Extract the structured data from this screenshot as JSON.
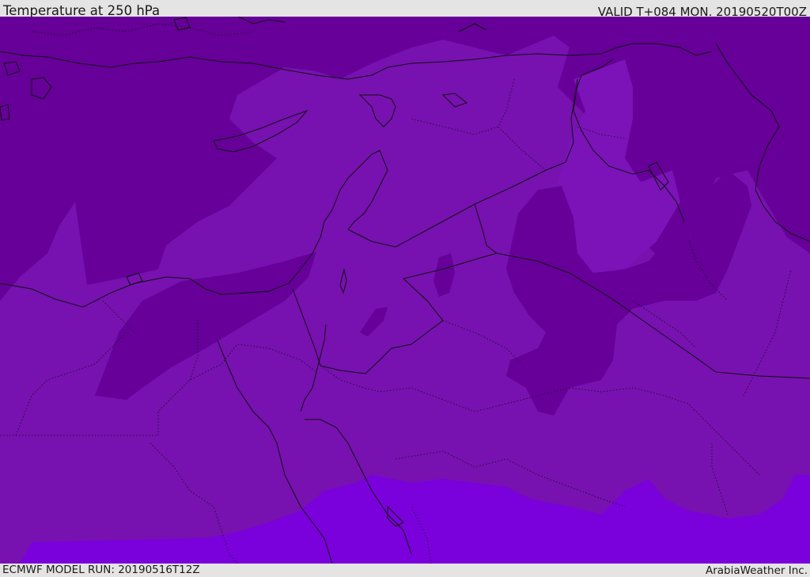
{
  "header": {
    "title": "Temperature at 250 hPa",
    "valid_time": "VALID T+084 MON. 20190520T00Z"
  },
  "footer": {
    "model_run": "ECMWF MODEL RUN: 20190516T12Z",
    "credit": "ArabiaWeather Inc."
  },
  "map": {
    "colors": {
      "coldest": "#660099",
      "cold": "#7711b0",
      "mild": "#7b13b8",
      "warm": "#7a00dc",
      "coastline": "#111111",
      "border": "#111111"
    }
  }
}
